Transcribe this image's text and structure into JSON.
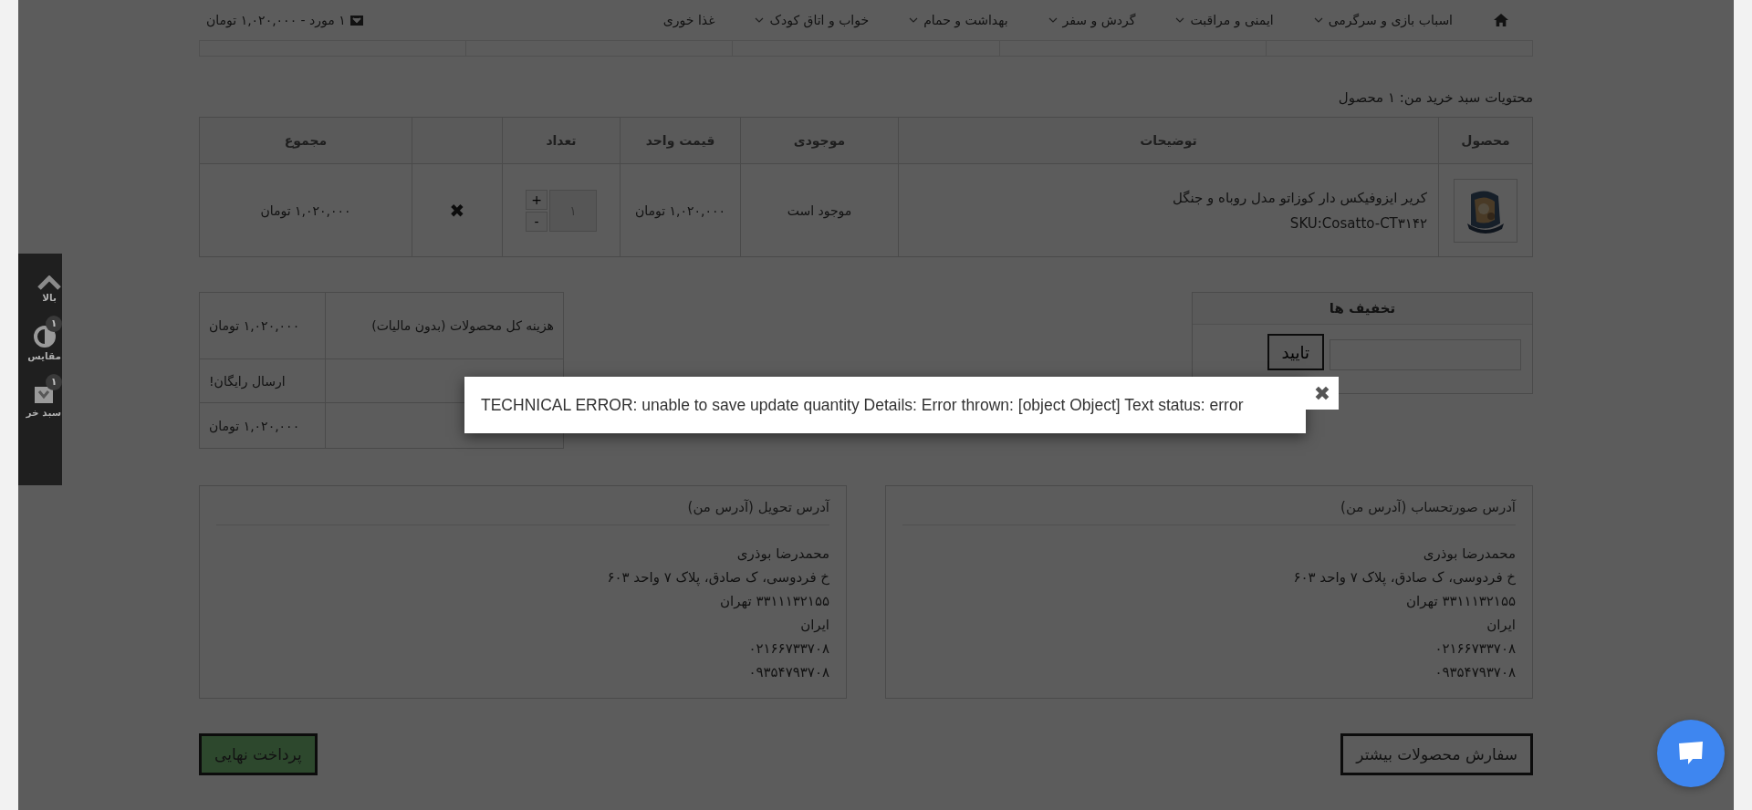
{
  "nav": {
    "items": [
      {
        "kind": "home"
      },
      {
        "kind": "link",
        "label": "اسباب بازی و سرگرمی",
        "has_dropdown": true
      },
      {
        "kind": "link",
        "label": "ایمنی و مراقبت",
        "has_dropdown": true
      },
      {
        "kind": "link",
        "label": "گردش و سفر",
        "has_dropdown": true
      },
      {
        "kind": "link",
        "label": "بهداشت و حمام",
        "has_dropdown": true
      },
      {
        "kind": "link",
        "label": "خواب و اتاق کودک",
        "has_dropdown": true
      },
      {
        "kind": "link",
        "label": "غذا خوری",
        "has_dropdown": false
      }
    ],
    "cart_summary": "۱ مورد - ۱,۰۲۰,۰۰۰ تومان"
  },
  "side_widget": {
    "items": [
      {
        "kind": "top",
        "label": "بالا"
      },
      {
        "kind": "compare",
        "label": "مقایس",
        "badge": "۱"
      },
      {
        "kind": "cart",
        "label": "سبد خر",
        "badge": "۱"
      }
    ]
  },
  "cart": {
    "title": "محتویات سبد خرید من: ۱ محصول",
    "columns": {
      "product": "محصول",
      "description": "توضیحات",
      "stock": "موجودی",
      "unit_price": "قیمت واحد",
      "quantity": "تعداد",
      "total": "مجموع"
    },
    "rows": [
      {
        "name": "کریر ایزوفیکس دار کوزاتو مدل روباه و جنگل",
        "sku": "SKU:Cosatto-CT۳۱۴۲",
        "stock": "موجود است",
        "unit_price": "۱,۰۲۰,۰۰۰ تومان",
        "quantity": "۱",
        "increment": "+",
        "decrement": "-",
        "remove": "✖",
        "total": "۱,۰۲۰,۰۰۰ تومان"
      }
    ]
  },
  "summary": {
    "rows": [
      {
        "label": "هزینه کل محصولات (بدون مالیات)",
        "value": "۱,۰۲۰,۰۰۰ تومان"
      },
      {
        "value": "ارسال رایگان!"
      },
      {
        "value": "۱,۰۲۰,۰۰۰ تومان"
      }
    ]
  },
  "discount": {
    "title": "تخفیف ها",
    "button": "تایید"
  },
  "addresses": [
    {
      "title": "آدرس صورتحساب (آدرس من)",
      "lines": [
        "محمدرضا بوذری",
        "خ فردوسی، ک صادق، پلاک ۷ واحد ۶۰۳",
        "۳۳۱۱۱۳۲۱۵۵ تهران",
        "ایران",
        "۰۲۱۶۶۷۳۳۷۰۸",
        "۰۹۳۵۴۷۹۳۷۰۸"
      ]
    },
    {
      "title": "آدرس تحویل (آدرس من)",
      "lines": [
        "محمدرضا بوذری",
        "خ فردوسی، ک صادق، پلاک ۷ واحد ۶۰۳",
        "۳۳۱۱۱۳۲۱۵۵ تهران",
        "ایران",
        "۰۲۱۶۶۷۳۳۷۰۸",
        "۰۹۳۵۴۷۹۳۷۰۸"
      ]
    }
  ],
  "buttons": {
    "continue": "سفارش محصولات بیشتر",
    "checkout": "پرداخت نهایی"
  },
  "modal": {
    "message": "TECHNICAL ERROR: unable to save update quantity Details: Error thrown: [object Object] Text status: error",
    "close": "✖"
  }
}
